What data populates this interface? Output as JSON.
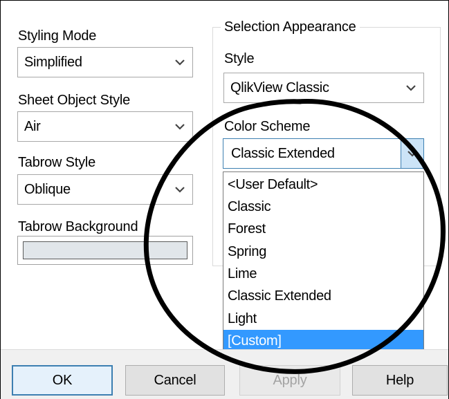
{
  "left": {
    "styling_mode": {
      "label": "Styling Mode",
      "value": "Simplified"
    },
    "sheet_object_style": {
      "label": "Sheet Object Style",
      "value": "Air"
    },
    "tabrow_style": {
      "label": "Tabrow Style",
      "value": "Oblique"
    },
    "tabrow_background": {
      "label": "Tabrow Background",
      "color": "#e1e6ea"
    }
  },
  "selection_appearance": {
    "title": "Selection Appearance",
    "style": {
      "label": "Style",
      "value": "QlikView Classic"
    },
    "color_scheme": {
      "label": "Color Scheme",
      "value": "Classic Extended",
      "options": [
        "<User Default>",
        "Classic",
        "Forest",
        "Spring",
        "Lime",
        "Classic Extended",
        "Light",
        "[Custom]"
      ],
      "highlighted_option": "[Custom]"
    }
  },
  "buttons": {
    "ok": "OK",
    "cancel": "Cancel",
    "apply": "Apply",
    "help": "Help"
  },
  "colors": {
    "accent": "#3399ff",
    "default_button_border": "#3c7fb1",
    "annotation_circle": "#000000"
  },
  "icons": {
    "dropdown": "chevron-down-icon",
    "annotation": "circle-annotation"
  }
}
